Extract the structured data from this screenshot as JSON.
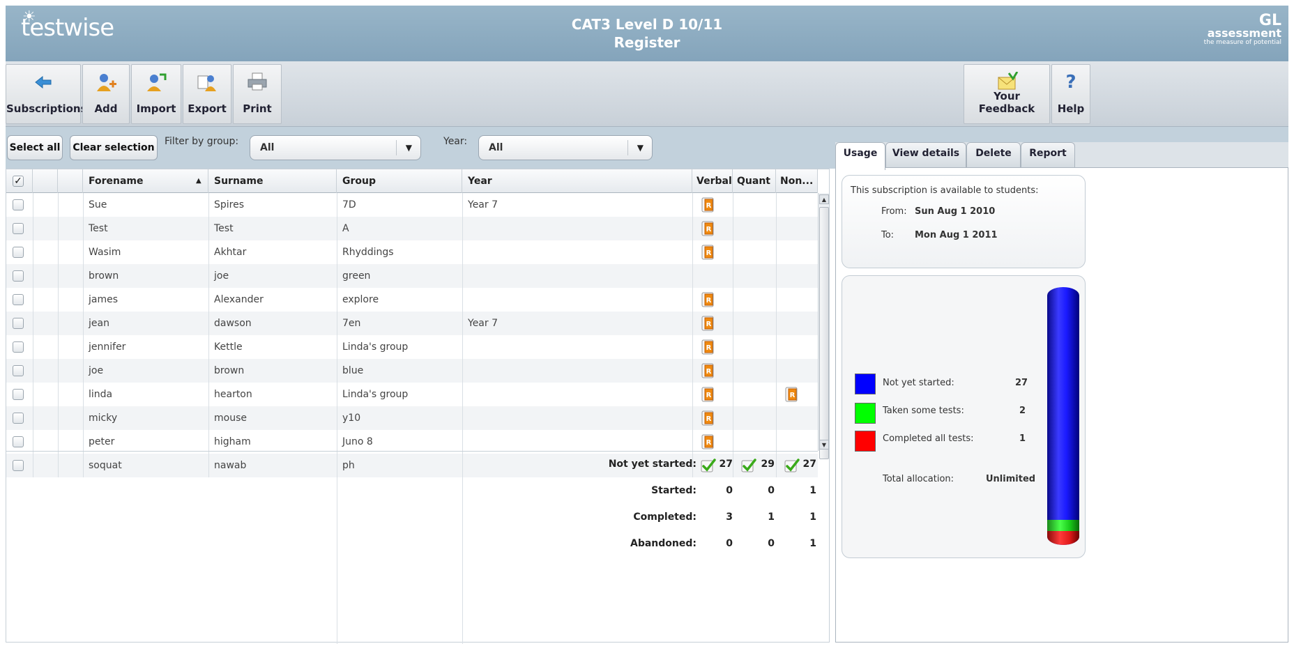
{
  "header": {
    "app_name": "testwise",
    "title_line1": "CAT3 Level D 10/11",
    "title_line2": "Register",
    "brand_gl": "GL",
    "brand_assessment": "assessment",
    "brand_tagline": "the measure of potential"
  },
  "toolbar": {
    "subscriptions": "Subscriptions",
    "add": "Add",
    "import": "Import",
    "export": "Export",
    "print": "Print",
    "feedback": "Your Feedback",
    "help": "Help"
  },
  "filters": {
    "select_all": "Select all",
    "clear_selection": "Clear selection",
    "group_label": "Filter by group:",
    "group_value": "All",
    "year_label": "Year:",
    "year_value": "All"
  },
  "grid": {
    "columns": [
      "Forename",
      "Surname",
      "Group",
      "Year",
      "Verbal",
      "Quant",
      "Non..."
    ],
    "rows": [
      {
        "forename": "Sue",
        "surname": "Spires",
        "group": "7D",
        "year": "Year 7"
      },
      {
        "forename": "Test",
        "surname": "Test",
        "group": "A",
        "year": ""
      },
      {
        "forename": "Wasim",
        "surname": "Akhtar",
        "group": "Rhyddings",
        "year": ""
      },
      {
        "forename": "brown",
        "surname": "joe",
        "group": "green",
        "year": ""
      },
      {
        "forename": "james",
        "surname": "Alexander",
        "group": "explore",
        "year": ""
      },
      {
        "forename": "jean",
        "surname": "dawson",
        "group": "7en",
        "year": "Year 7"
      },
      {
        "forename": "jennifer",
        "surname": "Kettle",
        "group": "Linda's group",
        "year": ""
      },
      {
        "forename": "joe",
        "surname": "brown",
        "group": "blue",
        "year": ""
      },
      {
        "forename": "linda",
        "surname": "hearton",
        "group": "Linda's group",
        "year": ""
      },
      {
        "forename": "micky",
        "surname": "mouse",
        "group": "y10",
        "year": ""
      },
      {
        "forename": "peter",
        "surname": "higham",
        "group": "Juno 8",
        "year": ""
      },
      {
        "forename": "soquat",
        "surname": "nawab",
        "group": "ph",
        "year": ""
      }
    ],
    "summary": [
      {
        "label": "Not yet started:",
        "verbal": "27",
        "quant": "29",
        "non": "27"
      },
      {
        "label": "Started:",
        "verbal": "0",
        "quant": "0",
        "non": "1"
      },
      {
        "label": "Completed:",
        "verbal": "3",
        "quant": "1",
        "non": "1"
      },
      {
        "label": "Abandoned:",
        "verbal": "0",
        "quant": "0",
        "non": "1"
      }
    ]
  },
  "panel": {
    "tabs": [
      "Usage",
      "View details",
      "Delete",
      "Report"
    ],
    "availability_text": "This subscription is available to students:",
    "from_label": "From:",
    "from_value": "Sun Aug 1 2010",
    "to_label": "To:",
    "to_value": "Mon Aug 1 2011",
    "legend": [
      {
        "label": "Not yet started:",
        "value": "27",
        "color": "#0000ff"
      },
      {
        "label": "Taken some tests:",
        "value": "2",
        "color": "#00ff00"
      },
      {
        "label": "Completed all tests:",
        "value": "1",
        "color": "#ff0000"
      }
    ],
    "allocation_label": "Total allocation:",
    "allocation_value": "Unlimited"
  }
}
